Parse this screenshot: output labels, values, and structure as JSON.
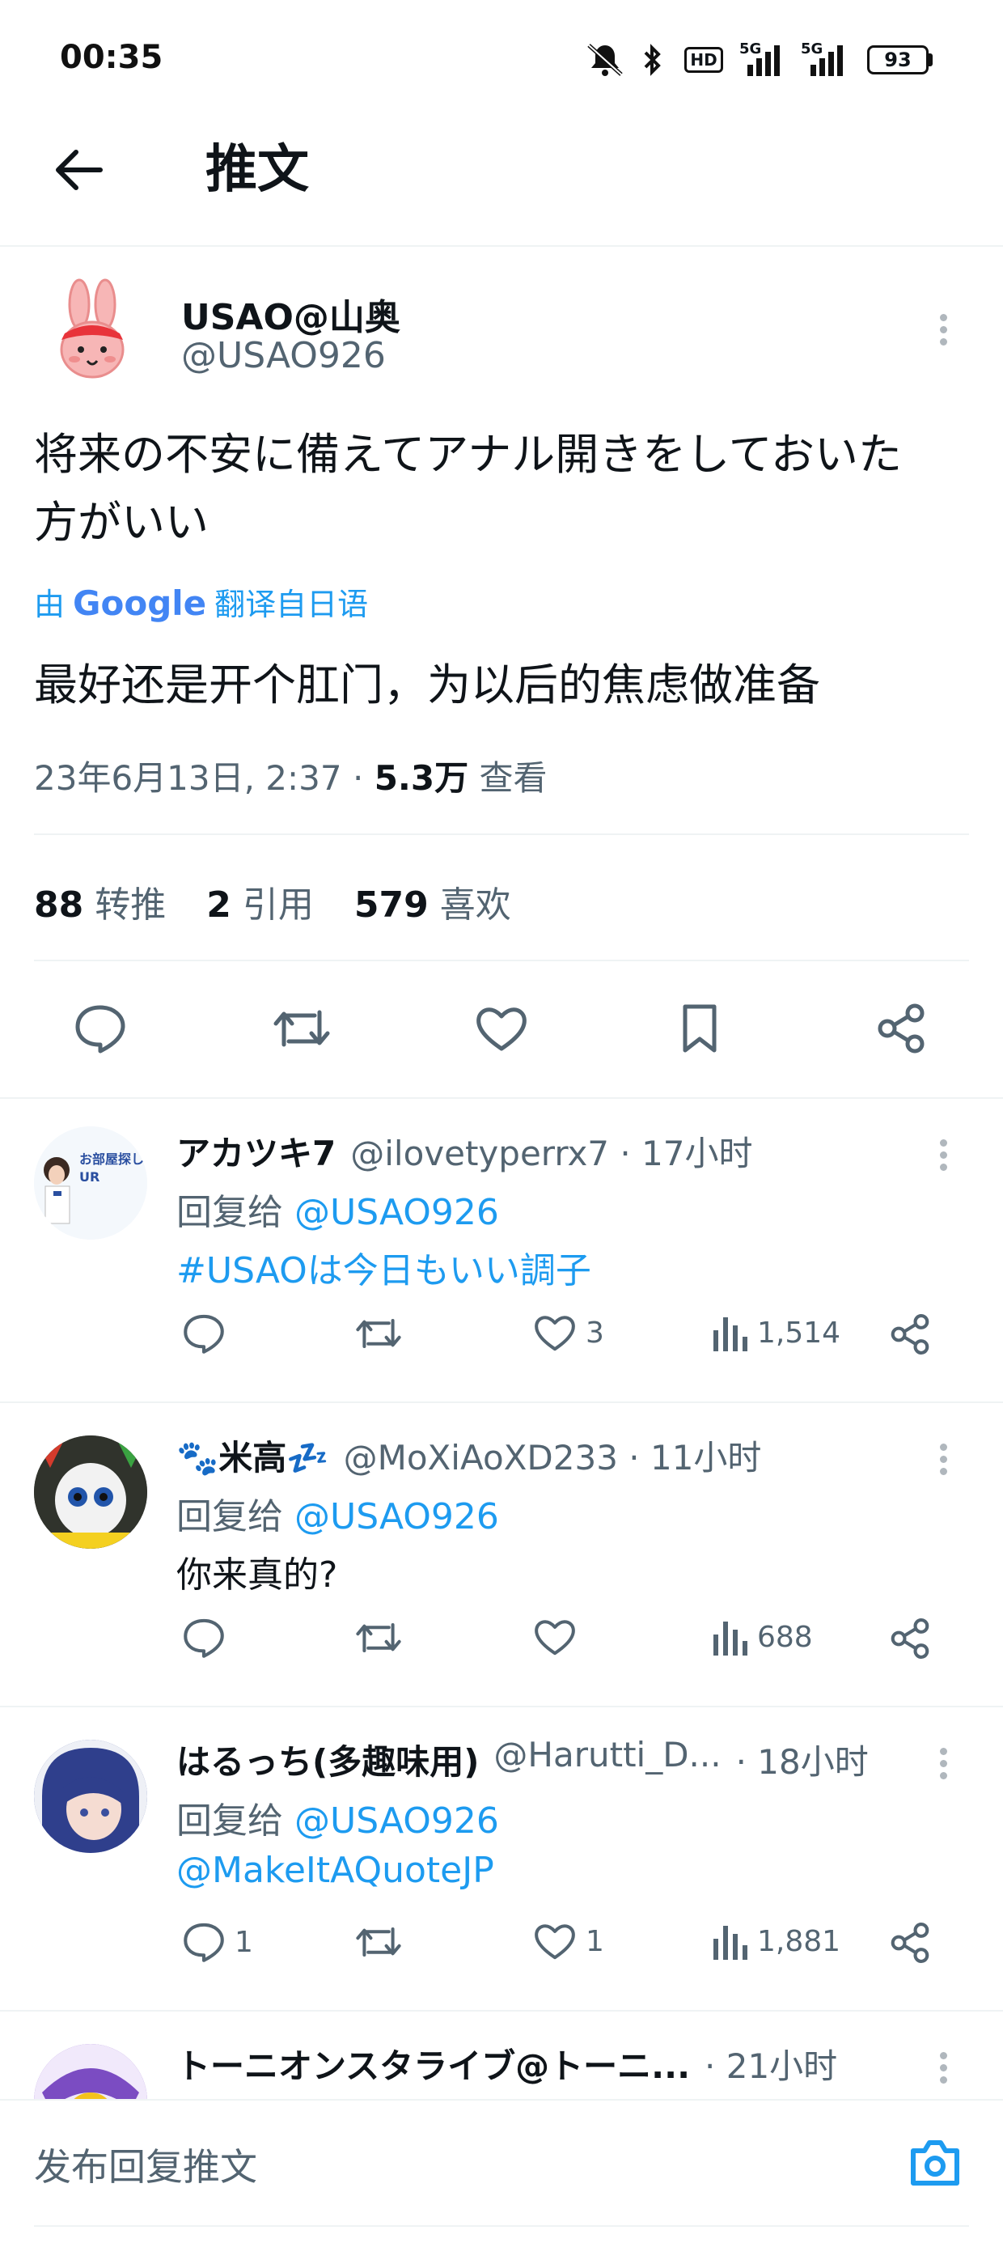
{
  "status_bar": {
    "time": "00:35",
    "hd_label": "HD",
    "signal1_label": "5G",
    "signal2_label": "5G",
    "battery": "93"
  },
  "header": {
    "title": "推文"
  },
  "tweet": {
    "display_name": "USAO@山奥",
    "handle": "@USAO926",
    "text_line1": "将来の不安に備えてアナル開きをしておいた",
    "text_line2": "方がいい",
    "translated_by_prefix": "由",
    "translated_by_brand": "Google",
    "translated_by_suffix": "翻译自日语",
    "translation": "最好还是开个肛门，为以后的焦虑做准备",
    "timestamp": "23年6月13日, 2:37 · ",
    "views_count": "5.3万",
    "views_label": " 查看",
    "stats": {
      "retweets": "88",
      "retweets_label": "转推",
      "quotes": "2",
      "quotes_label": "引用",
      "likes": "579",
      "likes_label": "喜欢"
    }
  },
  "replies": [
    {
      "display_name": "アカツキ7",
      "handle": "@ilovetyperrx7 · 17小时",
      "reply_prefix": "回复给",
      "reply_to": "@USAO926",
      "text": "#USAOは今日もいい調子",
      "avatar_text": "お部屋探し UR",
      "reply_count": "",
      "like_count": "3",
      "views": "1,514"
    },
    {
      "display_name": "🐾米高💤",
      "handle": "@MoXiAoXD233 · 11小时",
      "reply_prefix": "回复给",
      "reply_to": "@USAO926",
      "text": "你来真的?",
      "reply_count": "",
      "like_count": "",
      "views": "688"
    },
    {
      "display_name": "はるっち(多趣味用)",
      "handle": "@Harutti_D...",
      "time": "· 18小时",
      "reply_prefix": "回复给",
      "reply_to": "@USAO926",
      "text": "@MakeItAQuoteJP",
      "reply_count": "1",
      "like_count": "1",
      "views": "1,881"
    },
    {
      "display_name": "トーニオンスタライブ@トーニ...",
      "time": "· 21小时"
    }
  ],
  "compose": {
    "placeholder": "发布回复推文"
  },
  "colors": {
    "accent": "#1d9bf0",
    "text": "#0f1419",
    "secondary": "#536471",
    "divider": "#eff3f4"
  }
}
